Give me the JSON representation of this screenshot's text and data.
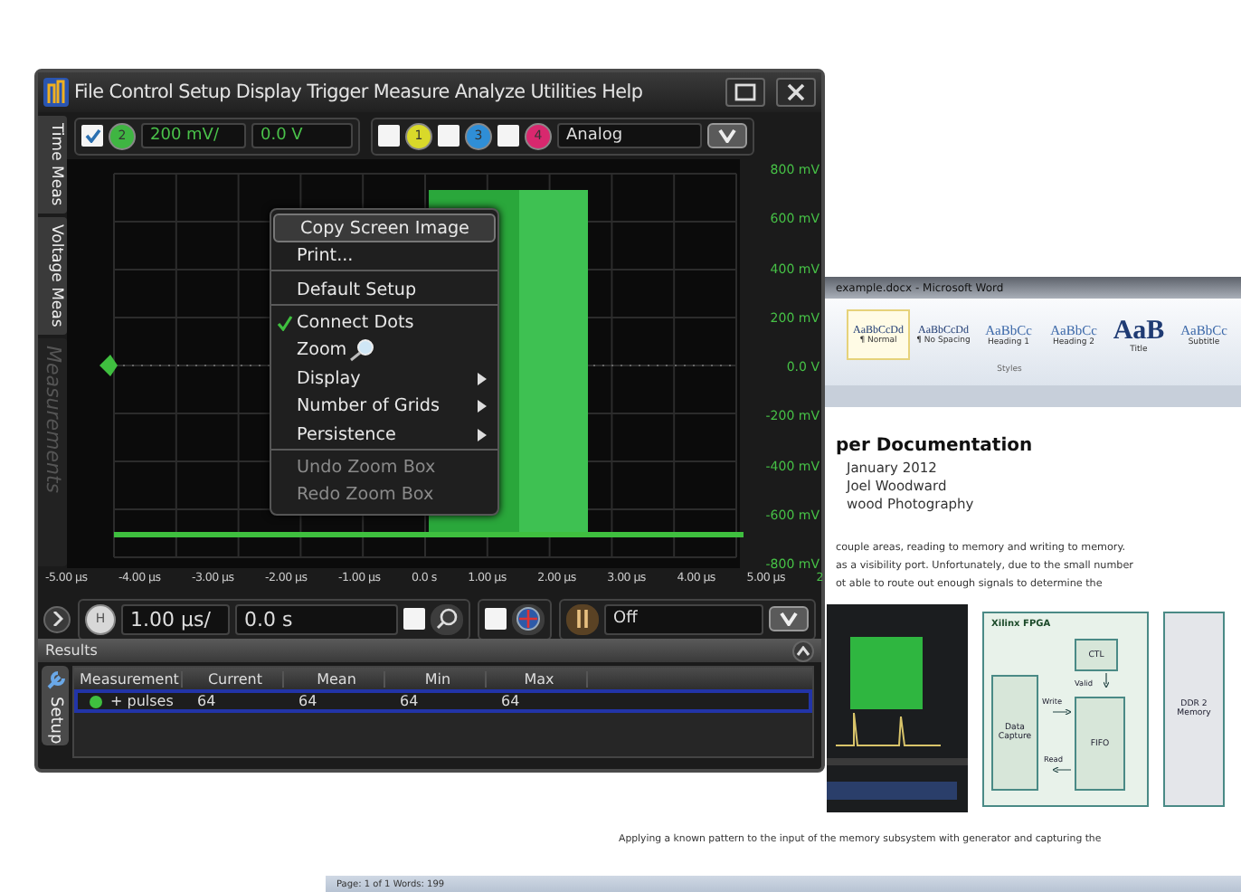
{
  "word_window": {
    "title": "example.docx - Microsoft Word",
    "styles": [
      {
        "sample": "AaBbCcDd",
        "name": "¶ Normal",
        "selected": true
      },
      {
        "sample": "AaBbCcDd",
        "name": "¶ No Spacing",
        "selected": false
      },
      {
        "sample": "AaBbCc",
        "name": "Heading 1",
        "selected": false
      },
      {
        "sample": "AaBbCc",
        "name": "Heading 2",
        "selected": false
      },
      {
        "sample": "AaB",
        "name": "Title",
        "selected": false
      },
      {
        "sample": "AaBbCc",
        "name": "Subtitle",
        "selected": false
      }
    ],
    "styles_group": "Styles",
    "heading": "per Documentation",
    "meta_lines": [
      "January 2012",
      "Joel Woodward",
      "wood Photography"
    ],
    "body_lines": [
      "couple areas, reading to memory and writing to memory.",
      "as a visibility port.  Unfortunately, due to the small number",
      "ot able to route out enough signals to determine the"
    ],
    "diagram": {
      "title": "Xilinx FPGA",
      "ctl": "CTL",
      "valid": "Valid",
      "write": "Write",
      "read": "Read",
      "capture": "Data Capture",
      "fifo": "FIFO",
      "memory": "DDR 2 Memory"
    },
    "footer_line": "Applying  a known pattern to the input of the memory subsystem with generator and capturing the",
    "status": "Page: 1 of 1   Words: 199"
  },
  "scope_window": {
    "menu": [
      "File",
      "Control",
      "Setup",
      "Display",
      "Trigger",
      "Measure",
      "Analyze",
      "Utilities",
      "Help"
    ],
    "active_channel": {
      "checked": true,
      "label": "2",
      "color": "#3fb542",
      "scale": "200 mV/",
      "offset": "0.0 V"
    },
    "channels": [
      {
        "label": "1",
        "checked": false,
        "color": "#d9d92a"
      },
      {
        "label": "3",
        "checked": false,
        "color": "#2f8ed6"
      },
      {
        "label": "4",
        "checked": false,
        "color": "#d8286e"
      }
    ],
    "mode": "Analog",
    "side_tabs": [
      {
        "label": "Time Meas",
        "selected": false
      },
      {
        "label": "Voltage Meas",
        "selected": false
      },
      {
        "label": "Measurements",
        "selected": true
      }
    ],
    "y_labels": [
      "800 mV",
      "600 mV",
      "400 mV",
      "200 mV",
      "0.0 V",
      "-200 mV",
      "-400 mV",
      "-600 mV",
      "-800 mV"
    ],
    "x_labels": [
      "-5.00 µs",
      "-4.00 µs",
      "-3.00 µs",
      "-2.00 µs",
      "-1.00 µs",
      "0.0 s",
      "1.00 µs",
      "2.00 µs",
      "3.00 µs",
      "4.00 µs",
      "5.00 µs"
    ],
    "x_end_label": "2",
    "context_menu": [
      {
        "label": "Copy Screen Image",
        "selected": true,
        "checked": false,
        "disabled": false,
        "submenu": false,
        "has_icon": false,
        "separator_after": false
      },
      {
        "label": "Print...",
        "selected": false,
        "checked": false,
        "disabled": false,
        "submenu": false,
        "has_icon": false,
        "separator_after": true
      },
      {
        "label": "Default Setup",
        "selected": false,
        "checked": false,
        "disabled": false,
        "submenu": false,
        "has_icon": false,
        "separator_after": true
      },
      {
        "label": "Connect Dots",
        "selected": false,
        "checked": true,
        "disabled": false,
        "submenu": false,
        "has_icon": false,
        "separator_after": false
      },
      {
        "label": "Zoom",
        "selected": false,
        "checked": false,
        "disabled": false,
        "submenu": false,
        "has_icon": true,
        "separator_after": false
      },
      {
        "label": "Display",
        "selected": false,
        "checked": false,
        "disabled": false,
        "submenu": true,
        "has_icon": false,
        "separator_after": false
      },
      {
        "label": "Number of Grids",
        "selected": false,
        "checked": false,
        "disabled": false,
        "submenu": true,
        "has_icon": false,
        "separator_after": false
      },
      {
        "label": "Persistence",
        "selected": false,
        "checked": false,
        "disabled": false,
        "submenu": true,
        "has_icon": false,
        "separator_after": true
      },
      {
        "label": "Undo Zoom Box",
        "selected": false,
        "checked": false,
        "disabled": true,
        "submenu": false,
        "has_icon": false,
        "separator_after": false
      },
      {
        "label": "Redo Zoom Box",
        "selected": false,
        "checked": false,
        "disabled": true,
        "submenu": false,
        "has_icon": false,
        "separator_after": false
      }
    ],
    "timebase": {
      "badge": "H",
      "scale": "1.00 µs/",
      "position": "0.0 s",
      "zoom_checked": false,
      "navigate_checked": false,
      "trigger_mode": "Off"
    },
    "results": {
      "title": "Results",
      "setup_tab": "Setup",
      "columns": [
        "Measurement",
        "Current",
        "Mean",
        "Min",
        "Max"
      ],
      "rows": [
        {
          "selected": true,
          "cells": [
            "+ pulses",
            "64",
            "64",
            "64",
            "64"
          ]
        }
      ]
    }
  }
}
